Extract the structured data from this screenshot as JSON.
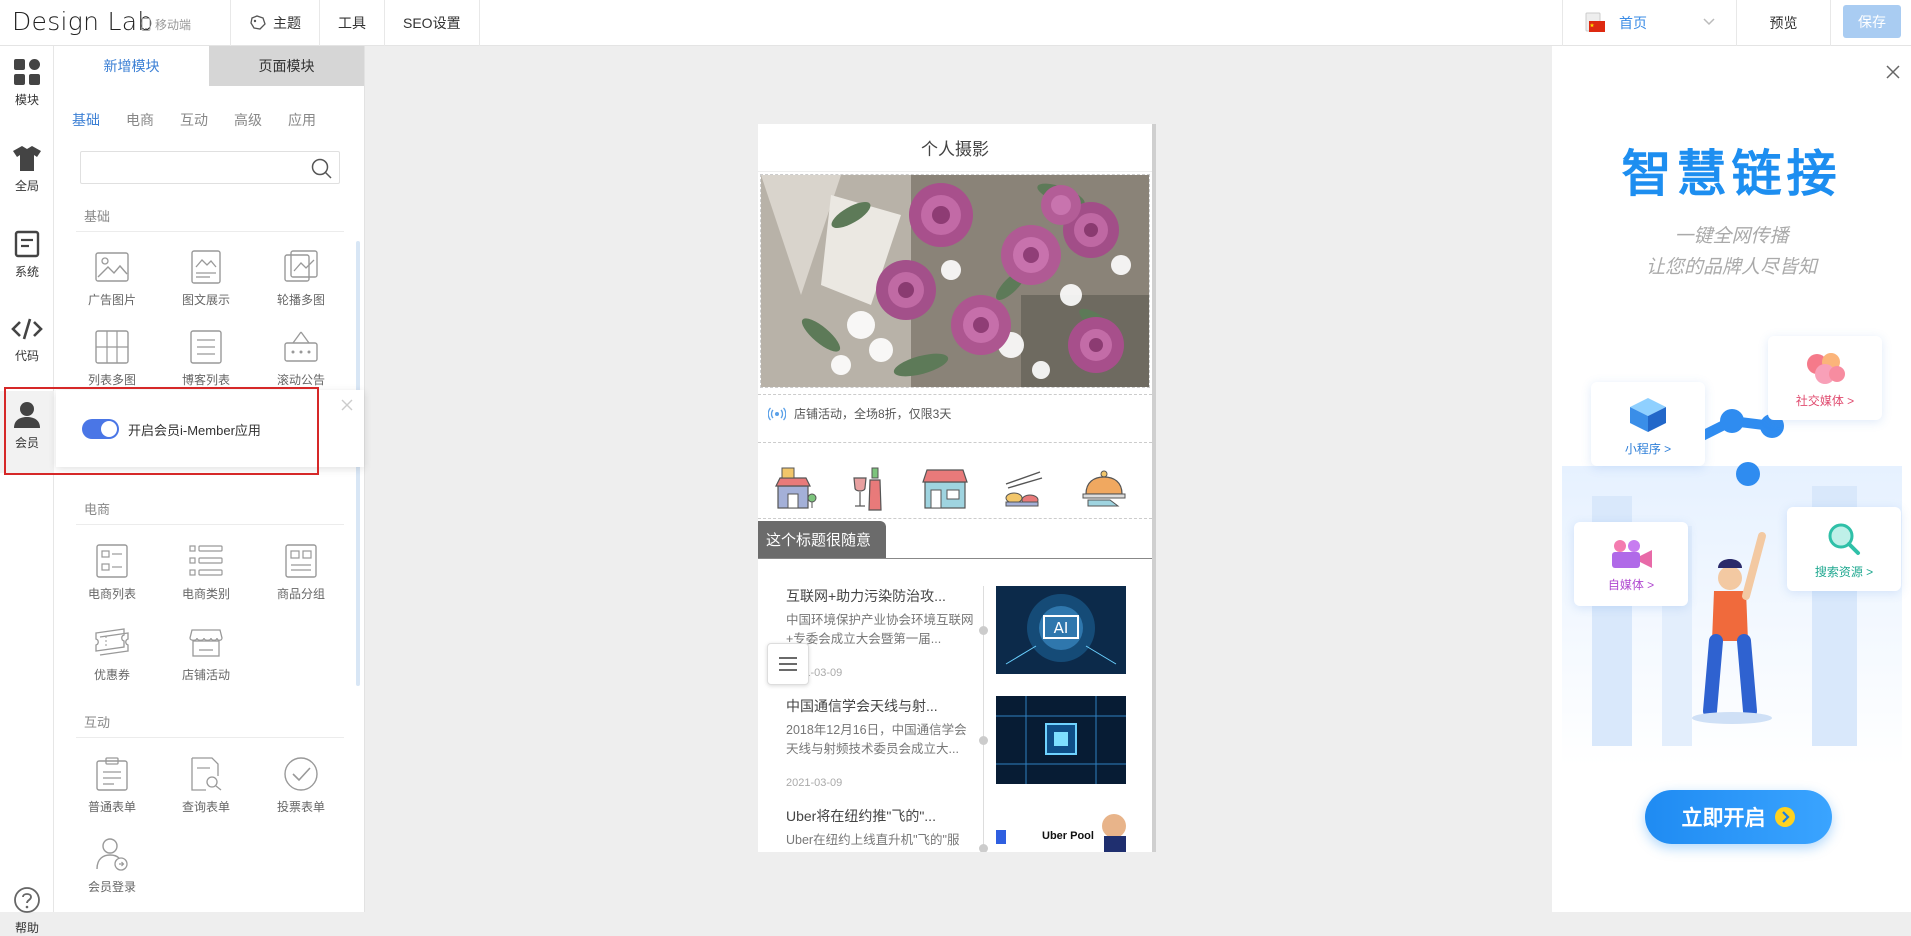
{
  "topbar": {
    "brand": "Design Lab",
    "mobile": "移动端",
    "menu": [
      {
        "label": "主题",
        "icon": "palette-icon"
      },
      {
        "label": "工具"
      },
      {
        "label": "SEO设置"
      }
    ],
    "page": "首页",
    "preview": "预览",
    "save": "保存"
  },
  "rail": [
    {
      "label": "模块",
      "icon": "grid-icon"
    },
    {
      "label": "全局",
      "icon": "shirt-icon"
    },
    {
      "label": "系统",
      "icon": "document-icon"
    },
    {
      "label": "代码",
      "icon": "code-icon"
    },
    {
      "label": "会员",
      "icon": "user-icon"
    }
  ],
  "help": "帮助",
  "panel": {
    "tabs": [
      "新增模块",
      "页面模块"
    ],
    "categories": [
      "基础",
      "电商",
      "互动",
      "高级",
      "应用"
    ],
    "search_placeholder": "",
    "sections": [
      {
        "title": "基础",
        "items": [
          "广告图片",
          "图文展示",
          "轮播多图",
          "列表多图",
          "博客列表",
          "滚动公告"
        ]
      },
      {
        "title": "电商",
        "items": [
          "电商列表",
          "电商类别",
          "商品分组",
          "优惠券",
          "店铺活动"
        ]
      },
      {
        "title": "互动",
        "items": [
          "普通表单",
          "查询表单",
          "投票表单",
          "会员登录"
        ]
      }
    ]
  },
  "member_popup": {
    "label": "开启会员i-Member应用",
    "enabled": true
  },
  "phone": {
    "title": "个人摄影",
    "notice": "店铺活动，全场8折，仅限3天",
    "section_title": "这个标题很随意",
    "news": [
      {
        "title": "互联网+助力污染防治攻...",
        "desc": "中国环境保护产业协会环境互联网+专委会成立大会暨第一届...",
        "date": "2021-03-09"
      },
      {
        "title": "中国通信学会天线与射...",
        "desc": "2018年12月16日，中国通信学会天线与射频技术委员会成立大...",
        "date": "2021-03-09"
      },
      {
        "title": "Uber将在纽约推\"飞的\"...",
        "desc": "Uber在纽约上线直升机\"飞的\"服",
        "date": ""
      }
    ],
    "img3_text": "Uber Pool"
  },
  "promo": {
    "title": "智慧链接",
    "sub1": "一键全网传播",
    "sub2": "让您的品牌人尽皆知",
    "cards": [
      "社交媒体 >",
      "小程序 >",
      "自媒体 >",
      "搜索资源 >"
    ],
    "cta": "立即开启"
  },
  "colors": {
    "accent": "#3b7fd4",
    "save_bg": "#a9ccf2",
    "toggle_on": "#4a76e6",
    "highlight": "#d62828",
    "promo_blue": "#1d8ef0"
  }
}
